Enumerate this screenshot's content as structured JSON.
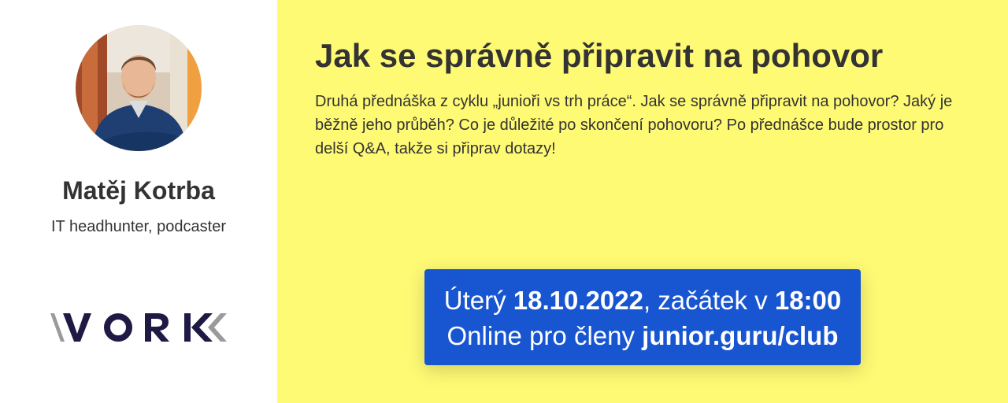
{
  "speaker": {
    "name": "Matěj Kotrba",
    "role": "IT headhunter, podcaster"
  },
  "sponsor": {
    "logo_text": "VORK",
    "logo_icon": "vork-logo"
  },
  "talk": {
    "title": "Jak se správně připravit na pohovor",
    "description": "Druhá přednáška z cyklu „junioři vs trh práce“. Jak se správně připravit na pohovor? Jaký je běžně jeho průběh? Co je důležité po skončení pohovoru? Po přednášce bude prostor pro delší Q&A, takže si připrav dotazy!"
  },
  "event": {
    "day": "Úterý",
    "date": "18.10.2022",
    "start_text": ", začátek v",
    "time": "18:00",
    "online_text": "Online pro členy",
    "link": "junior.guru/club"
  },
  "colors": {
    "sidebar_background": "#ffffff",
    "main_background": "#fffa74",
    "cta_background": "#1755d1",
    "text": "#333333",
    "logo_dark": "#1f1a44",
    "logo_grey": "#9a9a9a"
  }
}
